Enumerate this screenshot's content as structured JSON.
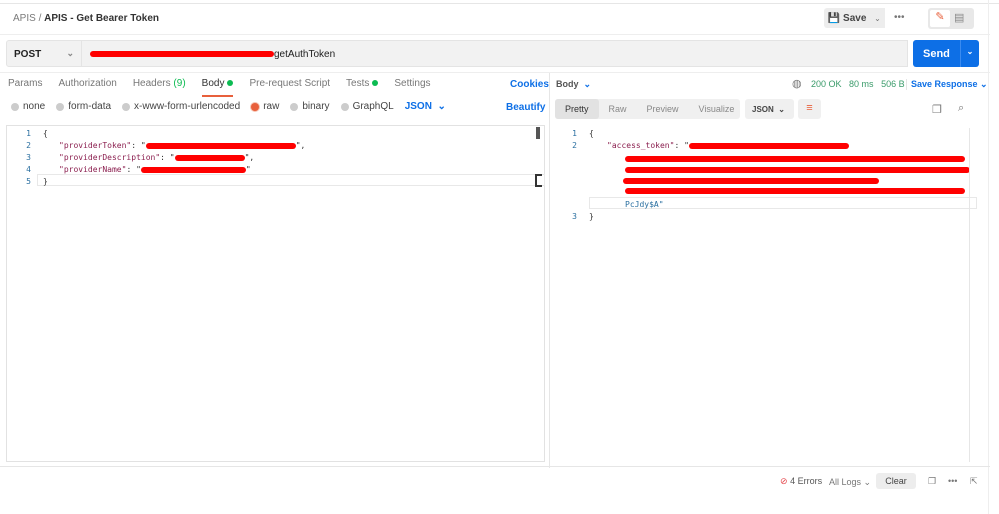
{
  "breadcrumb": {
    "parent": "APIS",
    "separator": "/",
    "title": "APIS - Get Bearer Token"
  },
  "header": {
    "save_label": "Save",
    "more": "•••"
  },
  "request": {
    "method": "POST",
    "url_visible": "getAuthToken",
    "send_label": "Send"
  },
  "request_tabs": [
    {
      "label": "Params"
    },
    {
      "label": "Authorization"
    },
    {
      "label": "Headers",
      "count": "(9)"
    },
    {
      "label": "Body"
    },
    {
      "label": "Pre-request Script"
    },
    {
      "label": "Tests"
    },
    {
      "label": "Settings"
    }
  ],
  "cookies_label": "Cookies",
  "body_types": [
    "none",
    "form-data",
    "x-www-form-urlencoded",
    "raw",
    "binary",
    "GraphQL"
  ],
  "body_format": "JSON",
  "beautify_label": "Beautify",
  "request_body": {
    "line_numbers": [
      "1",
      "2",
      "3",
      "4",
      "5"
    ],
    "open": "{",
    "close": "}",
    "keys": [
      "\"providerToken\"",
      "\"providerDescription\"",
      "\"providerName\""
    ]
  },
  "response": {
    "body_label": "Body",
    "status": "200 OK",
    "time": "80 ms",
    "size": "506 B",
    "save_label": "Save Response",
    "tabs": [
      "Pretty",
      "Raw",
      "Preview",
      "Visualize"
    ],
    "format": "JSON",
    "line_numbers": [
      "1",
      "2",
      "3"
    ],
    "open": "{",
    "close": "}",
    "key": "\"access_token\"",
    "token_tail": "PcJdy$A\""
  },
  "footer": {
    "errors": "4 Errors",
    "logs": "All Logs",
    "clear": "Clear"
  },
  "colors": {
    "accent": "#e8603c",
    "send": "#0d6fe6",
    "success": "#0cbb52",
    "redaction": "#ff0000"
  }
}
